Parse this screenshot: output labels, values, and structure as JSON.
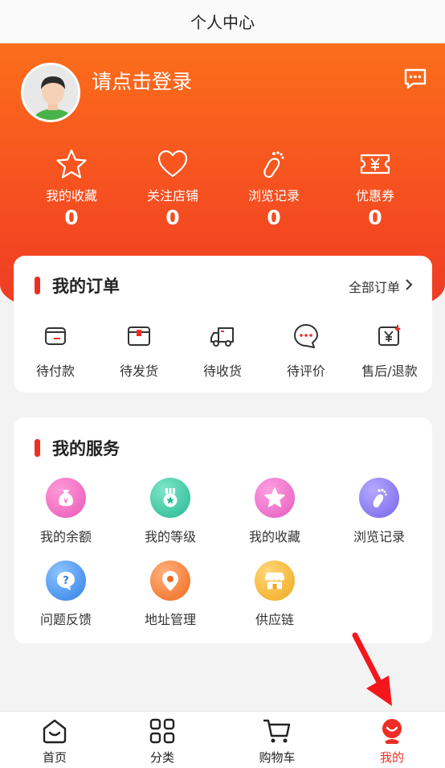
{
  "header": {
    "title": "个人中心"
  },
  "profile": {
    "login_prompt": "请点击登录",
    "avatar_icon": "user-avatar",
    "message_icon": "message-icon"
  },
  "stats": [
    {
      "label": "我的收藏",
      "value": "0",
      "icon": "star-icon"
    },
    {
      "label": "关注店铺",
      "value": "0",
      "icon": "heart-icon"
    },
    {
      "label": "浏览记录",
      "value": "0",
      "icon": "footprint-icon"
    },
    {
      "label": "优惠券",
      "value": "0",
      "icon": "coupon-icon"
    }
  ],
  "orders": {
    "title": "我的订单",
    "all_label": "全部订单",
    "items": [
      {
        "label": "待付款",
        "icon": "wallet-icon"
      },
      {
        "label": "待发货",
        "icon": "package-icon"
      },
      {
        "label": "待收货",
        "icon": "truck-icon"
      },
      {
        "label": "待评价",
        "icon": "comment-icon"
      },
      {
        "label": "售后/退款",
        "icon": "refund-icon"
      }
    ]
  },
  "services": {
    "title": "我的服务",
    "items": [
      {
        "label": "我的余额",
        "icon": "money-bag-icon",
        "color": "#f06bc0"
      },
      {
        "label": "我的等级",
        "icon": "medal-icon",
        "color": "#37c9a5"
      },
      {
        "label": "我的收藏",
        "icon": "star-icon",
        "color": "#f070c0"
      },
      {
        "label": "浏览记录",
        "icon": "footprint-icon",
        "color": "#8a7cf0"
      },
      {
        "label": "问题反馈",
        "icon": "question-icon",
        "color": "#3d8ff0"
      },
      {
        "label": "地址管理",
        "icon": "location-icon",
        "color": "#f5762a"
      },
      {
        "label": "供应链",
        "icon": "store-icon",
        "color": "#f5b22a"
      }
    ]
  },
  "tabbar": {
    "items": [
      {
        "label": "首页",
        "icon": "home-icon"
      },
      {
        "label": "分类",
        "icon": "grid-icon"
      },
      {
        "label": "购物车",
        "icon": "cart-icon"
      },
      {
        "label": "我的",
        "icon": "profile-icon"
      }
    ],
    "active_index": 3,
    "active_color": "#ee2e24"
  },
  "colors": {
    "brand": "#f65120",
    "accent": "#ee2e24"
  }
}
